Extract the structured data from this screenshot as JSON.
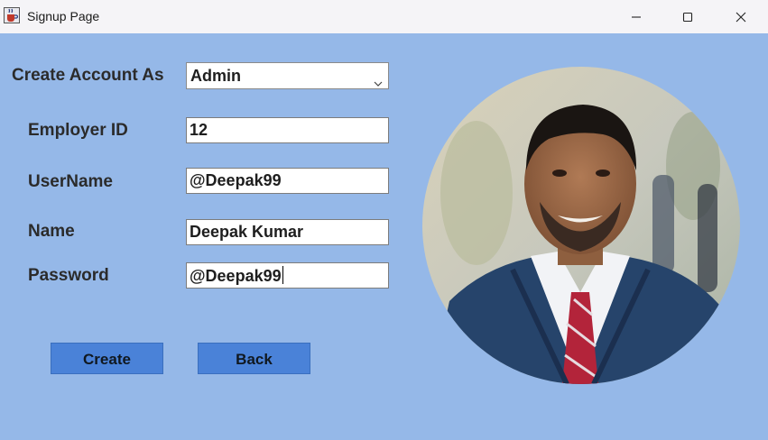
{
  "window": {
    "title": "Signup Page",
    "app_icon": "java-cup-icon",
    "controls": [
      "minimize-icon",
      "maximize-icon",
      "close-icon"
    ]
  },
  "form": {
    "account_type": {
      "label": "Create Account As",
      "value": "Admin"
    },
    "employer_id": {
      "label": "Employer ID",
      "value": "12"
    },
    "username": {
      "label": "UserName",
      "value": "@Deepak99"
    },
    "name": {
      "label": "Name",
      "value": "Deepak Kumar"
    },
    "password": {
      "label": "Password",
      "value": "@Deepak99"
    }
  },
  "buttons": {
    "create": "Create",
    "back": "Back"
  },
  "colors": {
    "background": "#95b8e8",
    "button": "#4a82d8",
    "titlebar": "#f5f4f7"
  }
}
